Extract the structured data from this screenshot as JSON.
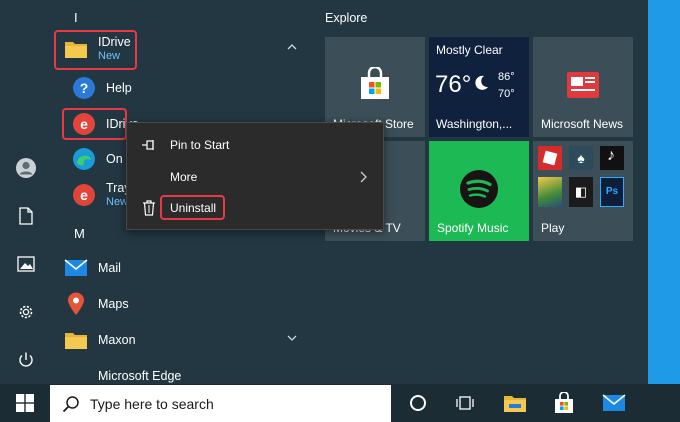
{
  "app_list": {
    "top_letter": "I",
    "idrive_group": {
      "label": "IDrive",
      "sub": "New"
    },
    "help": {
      "label": "Help"
    },
    "idrive_app": {
      "label": "IDrive"
    },
    "on_item": {
      "label": "On t"
    },
    "tray_item": {
      "label": "Tray",
      "sub": "New"
    },
    "m_letter": "M",
    "mail": {
      "label": "Mail"
    },
    "maps": {
      "label": "Maps"
    },
    "maxon": {
      "label": "Maxon"
    },
    "edge": {
      "label": "Microsoft Edge"
    }
  },
  "tiles": {
    "explore_title": "Explore",
    "store": {
      "label": "Microsoft Store"
    },
    "weather": {
      "condition": "Mostly Clear",
      "temp": "76°",
      "high": "86°",
      "low": "70°",
      "location": "Washington,..."
    },
    "news": {
      "label": "Microsoft News"
    },
    "movies": {
      "label": "Movies & TV"
    },
    "spotify": {
      "label": "Spotify Music"
    },
    "play": {
      "label": "Play"
    }
  },
  "context_menu": {
    "pin": "Pin to Start",
    "more": "More",
    "uninstall": "Uninstall"
  },
  "taskbar": {
    "search_placeholder": "Type here to search"
  },
  "colors": {
    "accent": "#1e9ae6",
    "highlight_red": "#e83a44",
    "spotify_green": "#1db954",
    "news_red": "#e03a3e"
  }
}
